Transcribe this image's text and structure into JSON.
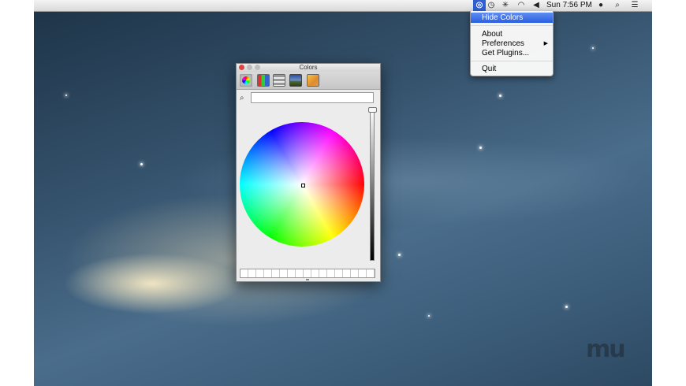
{
  "menubar": {
    "app_icon": "magnifier-app-icon",
    "status_icons": [
      "time-machine-icon",
      "bluetooth-icon",
      "wifi-icon",
      "volume-icon"
    ],
    "clock": "Sun 7:56 PM",
    "right_icons": [
      "user-icon",
      "spotlight-icon",
      "notification-center-icon"
    ]
  },
  "dropdown": {
    "items": [
      {
        "label": "Hide Colors",
        "highlighted": true
      },
      {
        "label": "About"
      },
      {
        "label": "Preferences",
        "has_submenu": true
      },
      {
        "label": "Get Plugins..."
      },
      {
        "label": "Quit"
      }
    ]
  },
  "colors_window": {
    "title": "Colors",
    "toolbar": [
      "color-wheel-tab",
      "color-sliders-tab",
      "color-palettes-tab",
      "image-palettes-tab",
      "crayons-tab"
    ],
    "search": {
      "value": "",
      "placeholder": ""
    }
  },
  "watermark": "mu"
}
